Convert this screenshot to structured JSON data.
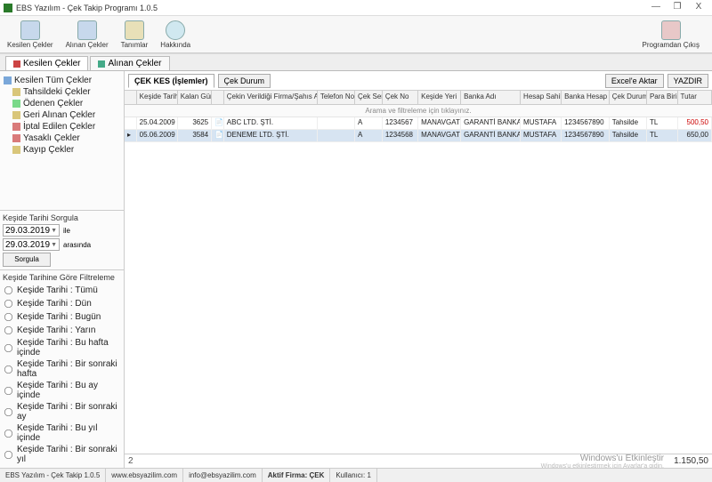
{
  "window": {
    "title": "EBS Yazılım - Çek Takip Programı 1.0.5",
    "min": "—",
    "restore": "❐",
    "close": "X"
  },
  "toolbar": {
    "kesilen": "Kesilen Çekler",
    "alinan": "Alınan Çekler",
    "tanimlar": "Tanımlar",
    "hakkinda": "Hakkında",
    "cikis": "Programdan Çıkış"
  },
  "mainTabs": {
    "kesilen": "Kesilen Çekler",
    "alinan": "Alınan Çekler"
  },
  "tree": {
    "root": "Kesilen Tüm Çekler",
    "items": [
      "Tahsildeki Çekler",
      "Ödenen Çekler",
      "Geri Alınan Çekler",
      "İptal Edilen Çekler",
      "Yasaklı Çekler",
      "Kayıp Çekler"
    ]
  },
  "dateQuery": {
    "title": "Keşide Tarihi Sorgula",
    "from": "29.03.2019",
    "to": "29.03.2019",
    "ile": "ile",
    "arasinda": "arasında",
    "sorgula": "Sorgula"
  },
  "dateFilter": {
    "title": "Keşide Tarihine Göre Filtreleme",
    "options": [
      "Keşide Tarihi : Tümü",
      "Keşide Tarihi : Dün",
      "Keşide Tarihi : Bugün",
      "Keşide Tarihi : Yarın",
      "Keşide Tarihi : Bu hafta içinde",
      "Keşide Tarihi : Bir sonraki hafta",
      "Keşide Tarihi : Bu ay içinde",
      "Keşide Tarihi : Bir sonraki ay",
      "Keşide Tarihi : Bu yıl içinde",
      "Keşide Tarihi : Bir sonraki yıl"
    ]
  },
  "panel": {
    "tab1": "ÇEK KES (İşlemler)",
    "tab2": "Çek Durum",
    "excel": "Excel'e Aktar",
    "yazdir": "YAZDIR"
  },
  "grid": {
    "headers": [
      "",
      "Keşide Tarihi",
      "Kalan Gün",
      "",
      "Çekin Verildiği Firma/Şahıs Adı",
      "Telefon No",
      "Çek Seri",
      "Çek No",
      "Keşide Yeri",
      "Banka Adı",
      "Hesap Sahibi",
      "Banka Hesap No",
      "Çek Durumu",
      "Para Birimi",
      "Tutar"
    ],
    "filterHint": "Arama ve filtreleme için tıklayınız.",
    "rows": [
      {
        "marker": "",
        "kesideTarihi": "25.04.2009",
        "kalanGun": "3625",
        "icon": "",
        "firma": "ABC LTD. ŞTİ.",
        "tel": "",
        "seri": "A",
        "cekNo": "1234567",
        "yeri": "MANAVGAT",
        "banka": "GARANTİ BANKASI",
        "sahip": "MUSTAFA",
        "hesapNo": "1234567890",
        "durum": "Tahsilde",
        "birim": "TL",
        "tutar": "500,50",
        "red": true
      },
      {
        "marker": "▸",
        "kesideTarihi": "05.06.2009",
        "kalanGun": "3584",
        "icon": "",
        "firma": "DENEME LTD. ŞTİ.",
        "tel": "",
        "seri": "A",
        "cekNo": "1234568",
        "yeri": "MANAVGAT",
        "banka": "GARANTİ BANKASI",
        "sahip": "MUSTAFA",
        "hesapNo": "1234567890",
        "durum": "Tahsilde",
        "birim": "TL",
        "tutar": "650,00",
        "red": false
      }
    ],
    "footer": {
      "count": "2",
      "watermark1": "Windows'u Etkinleştir",
      "watermark2": "Windows'u etkinleştirmek için Ayarlar'a gidin.",
      "total": "1.150,50"
    }
  },
  "status": {
    "app": "EBS Yazılım - Çek Takip 1.0.5",
    "site": "www.ebsyazilim.com",
    "mail": "info@ebsyazilim.com",
    "firma": "Aktif Firma: ÇEK",
    "kullanici": "Kullanıcı: 1"
  }
}
